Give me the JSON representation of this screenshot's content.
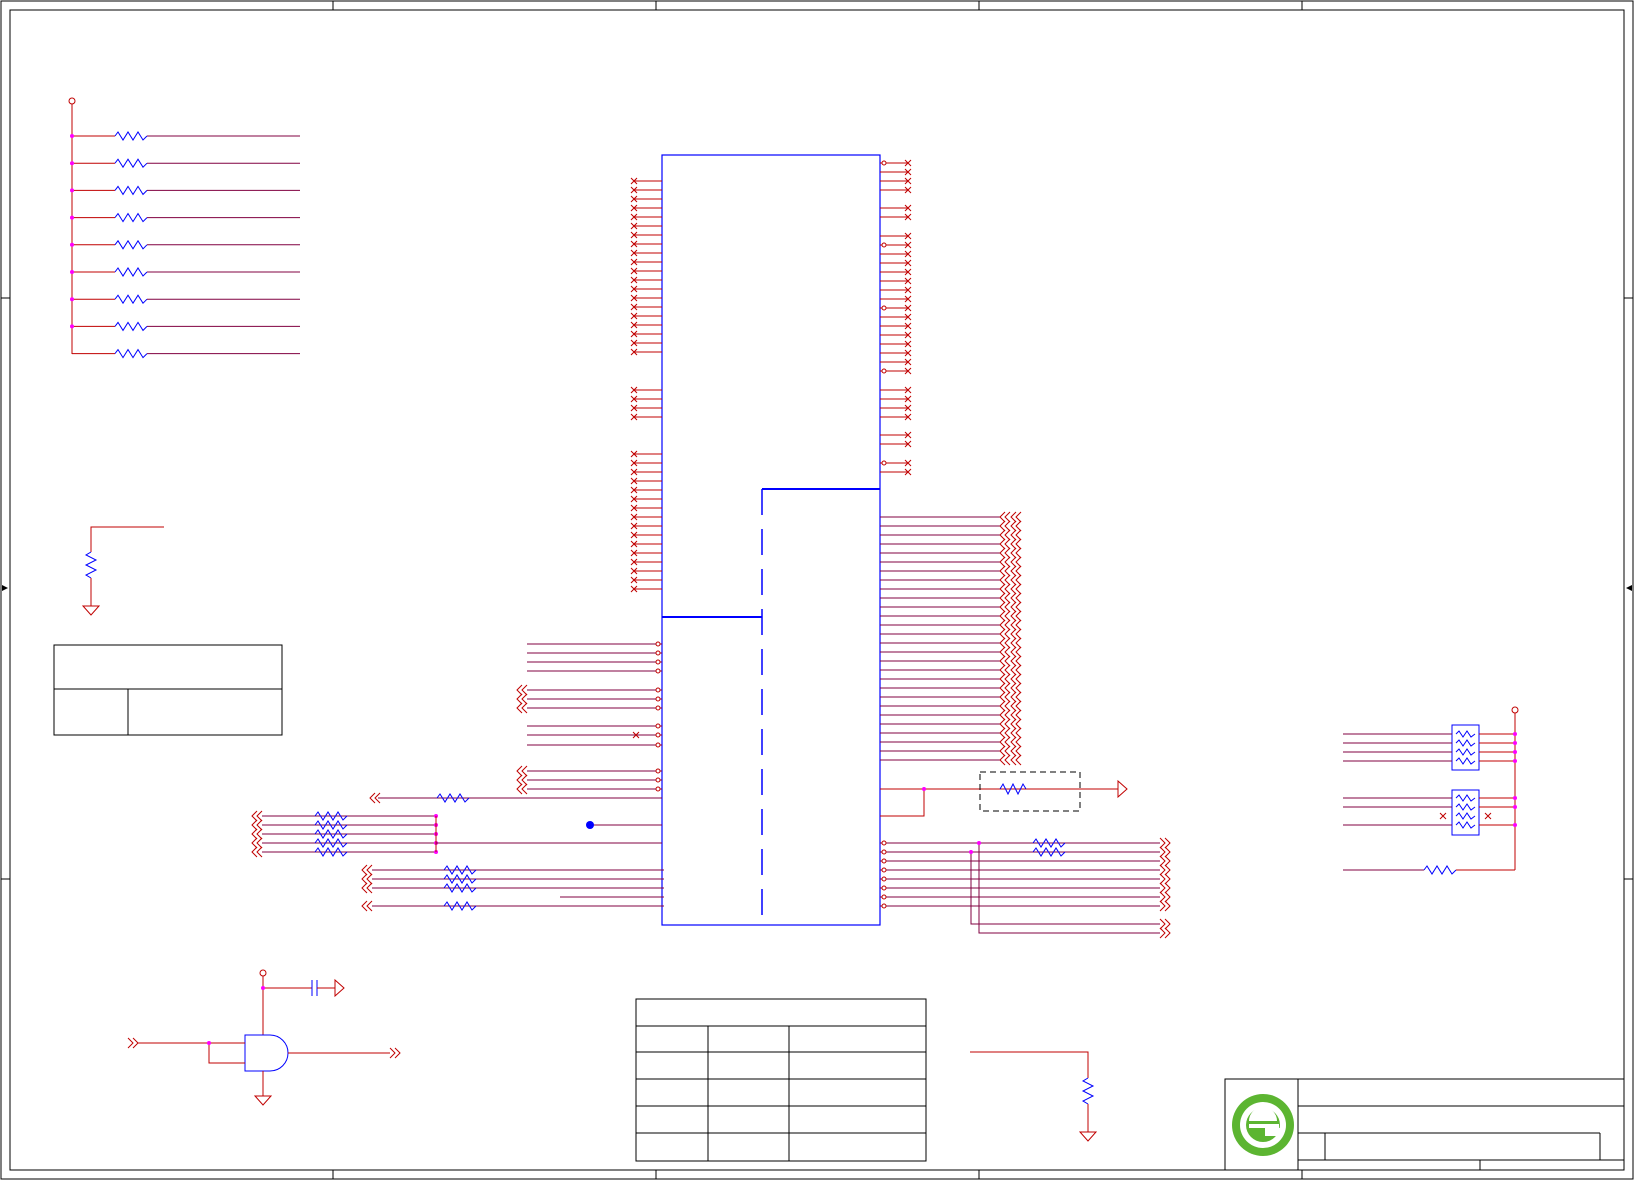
{
  "sheet": {
    "frame_color": "#000000",
    "wire_color": "#c00000",
    "net_color": "#800040",
    "part_color": "#0000ff",
    "junction_color": "#ff00ff",
    "title_block": {
      "logo_icon": "green-e-logo-icon",
      "logo_colors": [
        "#5cb531",
        "#ffffff"
      ],
      "title": "",
      "sheet_number": ""
    }
  }
}
